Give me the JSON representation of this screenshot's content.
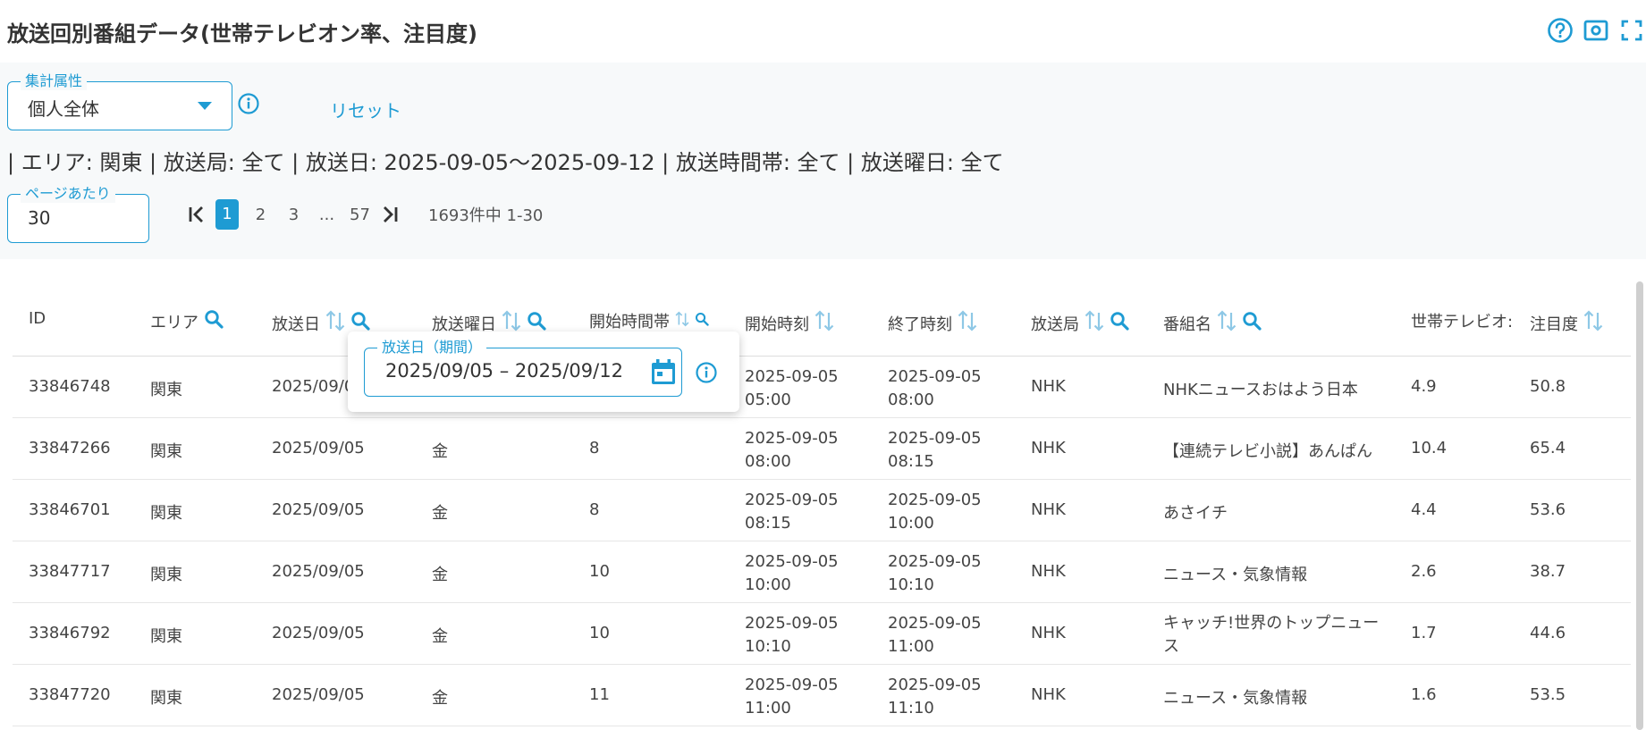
{
  "page": {
    "title": "放送回別番組データ(世帯テレビオン率、注目度)"
  },
  "filters": {
    "aggregation": {
      "legend": "集計属性",
      "value": "個人全体"
    },
    "reset_label": "リセット",
    "summary": "| エリア: 関東 | 放送局: 全て | 放送日: 2025-09-05〜2025-09-12 | 放送時間帯: 全て | 放送曜日: 全て",
    "per_page": {
      "legend": "ページあたり",
      "value": "30"
    }
  },
  "pagination": {
    "pages": [
      "1",
      "2",
      "3",
      "...",
      "57"
    ],
    "active": "1",
    "info": "1693件中 1-30"
  },
  "table": {
    "columns": [
      "ID",
      "エリア",
      "放送日",
      "放送曜日",
      "開始時間帯",
      "開始時刻",
      "終了時刻",
      "放送局",
      "番組名",
      "世帯テレビオ:",
      "注目度"
    ],
    "rows": [
      {
        "id": "33846748",
        "area": "関東",
        "date": "2025/09/0",
        "weekday": "",
        "slot": "",
        "start_date": "2025-09-05",
        "start_time": "05:00",
        "end_date": "2025-09-05",
        "end_time": "08:00",
        "station": "NHK",
        "program": "NHKニュースおはよう日本",
        "program2": "",
        "hut": "4.9",
        "attention": "50.8"
      },
      {
        "id": "33847266",
        "area": "関東",
        "date": "2025/09/05",
        "weekday": "金",
        "slot": "8",
        "start_date": "2025-09-05",
        "start_time": "08:00",
        "end_date": "2025-09-05",
        "end_time": "08:15",
        "station": "NHK",
        "program": "【連続テレビ小説】あんぱん",
        "program2": "",
        "hut": "10.4",
        "attention": "65.4"
      },
      {
        "id": "33846701",
        "area": "関東",
        "date": "2025/09/05",
        "weekday": "金",
        "slot": "8",
        "start_date": "2025-09-05",
        "start_time": "08:15",
        "end_date": "2025-09-05",
        "end_time": "10:00",
        "station": "NHK",
        "program": "あさイチ",
        "program2": "",
        "hut": "4.4",
        "attention": "53.6"
      },
      {
        "id": "33847717",
        "area": "関東",
        "date": "2025/09/05",
        "weekday": "金",
        "slot": "10",
        "start_date": "2025-09-05",
        "start_time": "10:00",
        "end_date": "2025-09-05",
        "end_time": "10:10",
        "station": "NHK",
        "program": "ニュース・気象情報",
        "program2": "",
        "hut": "2.6",
        "attention": "38.7"
      },
      {
        "id": "33846792",
        "area": "関東",
        "date": "2025/09/05",
        "weekday": "金",
        "slot": "10",
        "start_date": "2025-09-05",
        "start_time": "10:10",
        "end_date": "2025-09-05",
        "end_time": "11:00",
        "station": "NHK",
        "program": "キャッチ!世界のトップニュー",
        "program2": "ス",
        "hut": "1.7",
        "attention": "44.6"
      },
      {
        "id": "33847720",
        "area": "関東",
        "date": "2025/09/05",
        "weekday": "金",
        "slot": "11",
        "start_date": "2025-09-05",
        "start_time": "11:00",
        "end_date": "2025-09-05",
        "end_time": "11:10",
        "station": "NHK",
        "program": "ニュース・気象情報",
        "program2": "",
        "hut": "1.6",
        "attention": "53.5"
      }
    ]
  },
  "date_popover": {
    "legend": "放送日（期間）",
    "value": "2025/09/05 – 2025/09/12"
  },
  "icons": {
    "accent": "#1e9bd3",
    "help": "help-circle-icon",
    "screenshot": "camera-icon",
    "fullscreen": "fullscreen-icon",
    "info": "info-icon",
    "search": "search-icon",
    "sort": "sort-icon",
    "calendar": "calendar-icon"
  }
}
